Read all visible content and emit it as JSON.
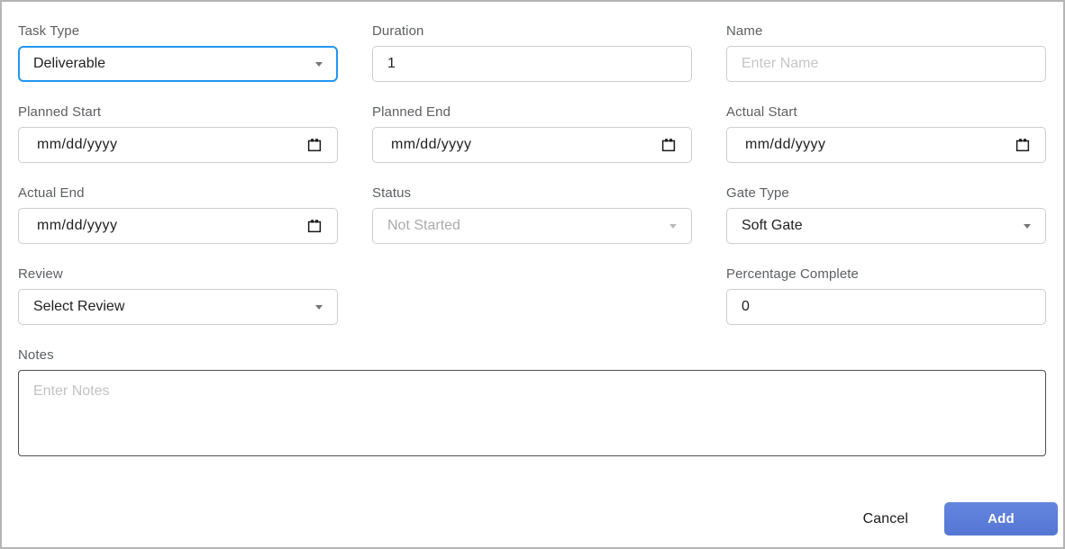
{
  "dialog": {
    "fields": {
      "task_type": {
        "label": "Task Type",
        "value": "Deliverable"
      },
      "duration": {
        "label": "Duration",
        "value": "1"
      },
      "name": {
        "label": "Name",
        "placeholder": "Enter Name"
      },
      "planned_start": {
        "label": "Planned Start",
        "value": "mm/dd/yyyy"
      },
      "planned_end": {
        "label": "Planned End",
        "value": "mm/dd/yyyy"
      },
      "actual_start": {
        "label": "Actual Start",
        "value": "mm/dd/yyyy"
      },
      "actual_end": {
        "label": "Actual End",
        "value": "mm/dd/yyyy"
      },
      "status": {
        "label": "Status",
        "value": "Not Started"
      },
      "gate_type": {
        "label": "Gate Type",
        "value": "Soft Gate"
      },
      "review": {
        "label": "Review",
        "value": "Select Review"
      },
      "percentage_complete": {
        "label": "Percentage Complete",
        "value": "0"
      },
      "notes": {
        "label": "Notes",
        "placeholder": "Enter Notes"
      }
    },
    "buttons": {
      "cancel_label": "Cancel",
      "add_label": "Add"
    },
    "colors": {
      "focus_border": "#2196f3",
      "primary_button_blue": "#5b7ed9",
      "field_border": "#cdcdcd",
      "label_gray": "#5c5f63"
    }
  }
}
